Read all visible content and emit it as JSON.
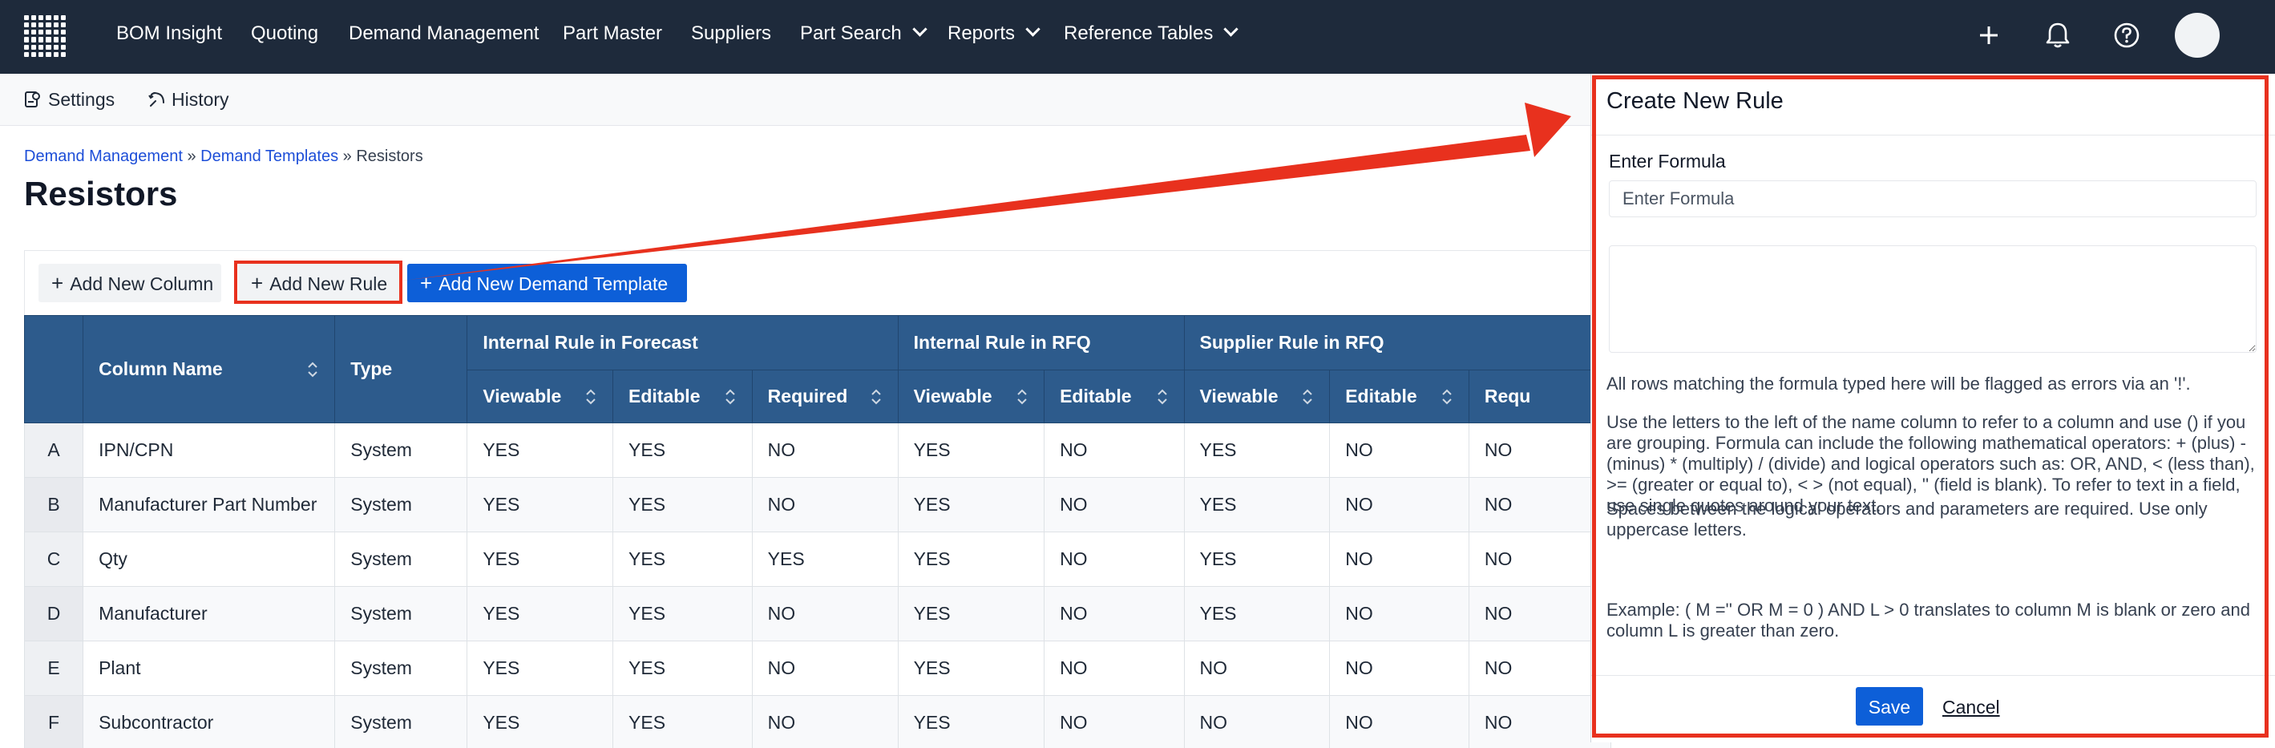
{
  "topnav": {
    "items": [
      {
        "label": "BOM Insight"
      },
      {
        "label": "Quoting"
      },
      {
        "label": "Demand Management"
      },
      {
        "label": "Part Master"
      },
      {
        "label": "Suppliers"
      },
      {
        "label": "Part Search",
        "dropdown": true
      },
      {
        "label": "Reports",
        "dropdown": true
      },
      {
        "label": "Reference Tables",
        "dropdown": true
      }
    ],
    "icons": [
      "plus-icon",
      "bell-icon",
      "help-icon",
      "avatar"
    ],
    "background": "#1e2a3b"
  },
  "subbar": {
    "settings_label": "Settings",
    "history_label": "History"
  },
  "breadcrumb": {
    "items": [
      "Demand Management",
      "Demand Templates",
      "Resistors"
    ],
    "separator": "»"
  },
  "page": {
    "title": "Resistors"
  },
  "actions": {
    "add_column": "Add New Column",
    "add_rule": "Add New Rule",
    "add_template": "Add New Demand Template",
    "plus": "+"
  },
  "table": {
    "headers": {
      "column_name": "Column Name",
      "type": "Type",
      "group_forecast": "Internal Rule in Forecast",
      "group_rfq": "Internal Rule in RFQ",
      "group_supplier": "Supplier Rule in RFQ",
      "viewable": "Viewable",
      "editable": "Editable",
      "required": "Required",
      "required_cut": "Requ"
    },
    "rows": [
      [
        "A",
        "IPN/CPN",
        "System",
        "YES",
        "YES",
        "NO",
        "YES",
        "NO",
        "YES",
        "NO",
        "NO"
      ],
      [
        "B",
        "Manufacturer Part Number",
        "System",
        "YES",
        "YES",
        "NO",
        "YES",
        "NO",
        "YES",
        "NO",
        "NO"
      ],
      [
        "C",
        "Qty",
        "System",
        "YES",
        "YES",
        "YES",
        "YES",
        "NO",
        "YES",
        "NO",
        "NO"
      ],
      [
        "D",
        "Manufacturer",
        "System",
        "YES",
        "YES",
        "NO",
        "YES",
        "NO",
        "YES",
        "NO",
        "NO"
      ],
      [
        "E",
        "Plant",
        "System",
        "YES",
        "YES",
        "NO",
        "YES",
        "NO",
        "NO",
        "NO",
        "NO"
      ],
      [
        "F",
        "Subcontractor",
        "System",
        "YES",
        "YES",
        "NO",
        "YES",
        "NO",
        "NO",
        "NO",
        "NO"
      ]
    ],
    "header_color": "#2d5b8c"
  },
  "panel": {
    "title": "Create New Rule",
    "formula_label": "Enter Formula",
    "formula_placeholder": "Enter Formula",
    "help1": "All rows matching the formula typed here will be flagged as errors via an '!'.",
    "help2": "Use the letters to the left of the name column to refer to a column and use () if you are grouping. Formula can include the following mathematical operators: + (plus) - (minus) * (multiply) / (divide) and logical operators such as: OR, AND, < (less than), >= (greater or equal to), < > (not equal), '' (field is blank). To refer to text in a field, use single quotes around your text.",
    "help3": "Spaces between the logical operators and parameters are required. Use only uppercase letters.",
    "help4": "Example: ( M ='' OR M = 0 ) AND L > 0 translates to column M is blank or zero and column L is greater than zero.",
    "save": "Save",
    "cancel": "Cancel"
  },
  "colors": {
    "primary": "#0d5fd8",
    "annotation": "#e8311e"
  }
}
